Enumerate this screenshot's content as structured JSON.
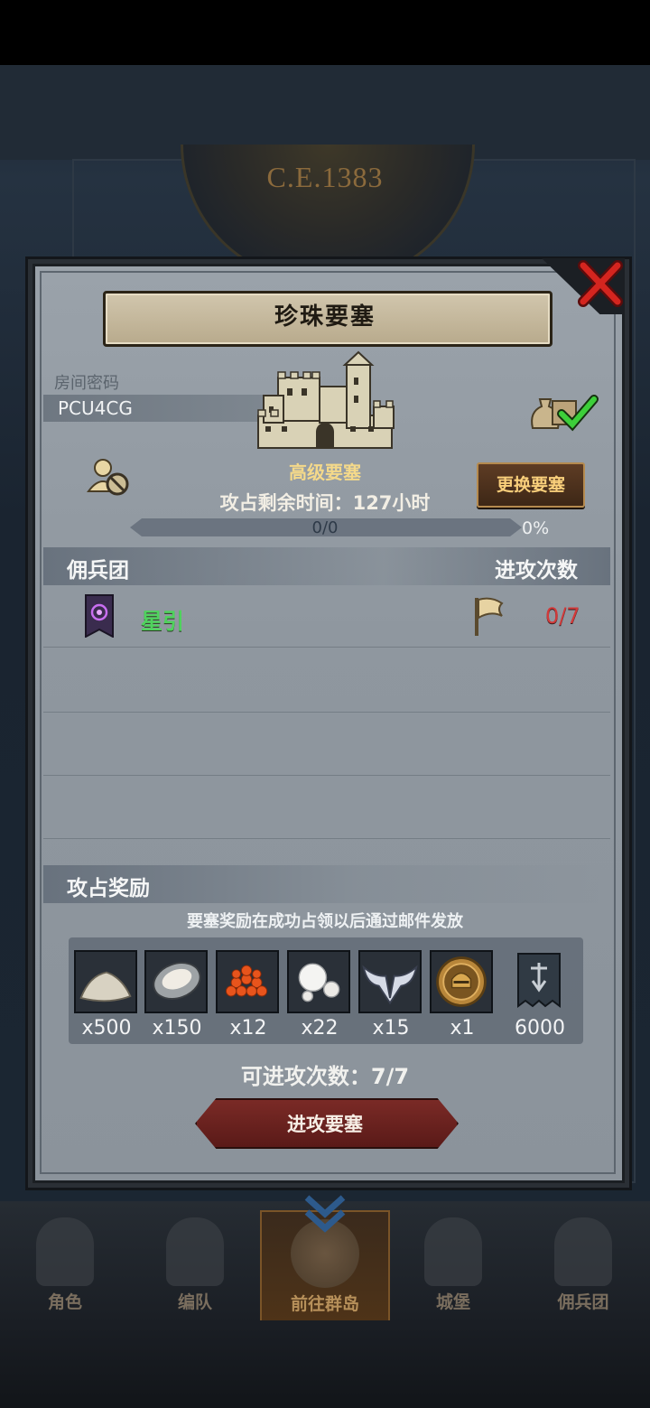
{
  "background": {
    "era_text": "C.E.1383"
  },
  "bottom_nav": {
    "items": [
      {
        "label": "角色",
        "icon": "character-icon"
      },
      {
        "label": "编队",
        "icon": "formation-icon"
      },
      {
        "label": "前往群岛",
        "icon": "archipelago-icon"
      },
      {
        "label": "城堡",
        "icon": "castle-icon"
      },
      {
        "label": "佣兵团",
        "icon": "mercenary-icon"
      }
    ],
    "active": "前往群岛"
  },
  "dialog": {
    "title": "珍珠要塞",
    "room_code_label": "房间密码",
    "room_code": "PCU4CG",
    "fortress_type": "高级要塞",
    "time_remaining": "攻占剩余时间：127小时",
    "progress": {
      "current": 0,
      "total": 0,
      "text": "0/0",
      "percent": "0%",
      "fraction": 0
    },
    "change_button": "更换要塞",
    "table": {
      "col_left": "佣兵团",
      "col_right": "进攻次数",
      "rows": [
        {
          "name": "星引",
          "attacks": "0/7"
        }
      ]
    },
    "rewards": {
      "title": "攻占奖励",
      "note": "要塞奖励在成功占领以后通过邮件发放",
      "items": [
        {
          "icon": "sand-pile-icon",
          "qty": "x500"
        },
        {
          "icon": "oyster-icon",
          "qty": "x150"
        },
        {
          "icon": "fish-roe-icon",
          "qty": "x12"
        },
        {
          "icon": "pearl-icon",
          "qty": "x22"
        },
        {
          "icon": "winged-emblem-icon",
          "qty": "x15"
        },
        {
          "icon": "knight-helmet-coin-icon",
          "qty": "x1"
        },
        {
          "icon": "banner-icon",
          "qty": "6000"
        }
      ]
    },
    "available_attacks": "可进攻次数：7/7",
    "attack_button": "进攻要塞"
  },
  "colors": {
    "panel": "#8f979f",
    "guild_name": "#4fd35d",
    "attack_count": "#d23a3a",
    "fortress_type": "#f4d98a",
    "change_button_text": "#f9cf7b",
    "attack_button": "#6a2220"
  }
}
